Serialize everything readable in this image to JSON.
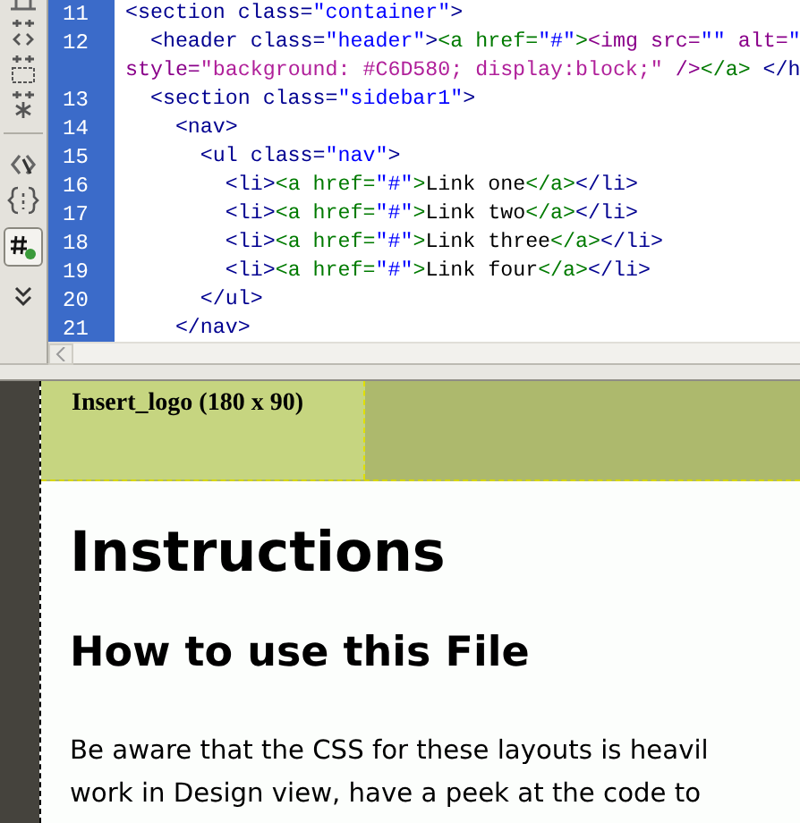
{
  "code_view": {
    "lines": [
      {
        "number": "11",
        "segments": [
          {
            "kind": "tag",
            "text": "<section class="
          },
          {
            "kind": "string",
            "text": "\"container\""
          },
          {
            "kind": "tag",
            "text": ">"
          }
        ]
      },
      {
        "number": "12",
        "segments": [
          {
            "kind": "tag",
            "text": "  <header class="
          },
          {
            "kind": "string",
            "text": "\"header\""
          },
          {
            "kind": "tag",
            "text": ">"
          },
          {
            "kind": "anchor",
            "text": "<a href="
          },
          {
            "kind": "string",
            "text": "\"#\""
          },
          {
            "kind": "anchor",
            "text": ">"
          },
          {
            "kind": "image",
            "text": "<img src="
          },
          {
            "kind": "string",
            "text": "\"\""
          },
          {
            "kind": "image",
            "text": " alt="
          },
          {
            "kind": "string",
            "text": "\""
          }
        ]
      },
      {
        "segments": [
          {
            "kind": "image",
            "text": "style="
          },
          {
            "kind": "css",
            "text": "\"background: #C6D580; display:block;\""
          },
          {
            "kind": "image",
            "text": " />"
          },
          {
            "kind": "anchor",
            "text": "</a>"
          },
          {
            "kind": "tag",
            "text": " </h"
          }
        ]
      },
      {
        "number": "13",
        "segments": [
          {
            "kind": "tag",
            "text": "  <section class="
          },
          {
            "kind": "string",
            "text": "\"sidebar1\""
          },
          {
            "kind": "tag",
            "text": ">"
          }
        ]
      },
      {
        "number": "14",
        "segments": [
          {
            "kind": "tag",
            "text": "    <nav>"
          }
        ]
      },
      {
        "number": "15",
        "segments": [
          {
            "kind": "tag",
            "text": "      <ul class="
          },
          {
            "kind": "string",
            "text": "\"nav\""
          },
          {
            "kind": "tag",
            "text": ">"
          }
        ]
      },
      {
        "number": "16",
        "segments": [
          {
            "kind": "tag",
            "text": "        <li>"
          },
          {
            "kind": "anchor",
            "text": "<a href="
          },
          {
            "kind": "string",
            "text": "\"#\""
          },
          {
            "kind": "anchor",
            "text": ">"
          },
          {
            "kind": "text",
            "text": "Link one"
          },
          {
            "kind": "anchor",
            "text": "</a>"
          },
          {
            "kind": "tag",
            "text": "</li>"
          }
        ]
      },
      {
        "number": "17",
        "segments": [
          {
            "kind": "tag",
            "text": "        <li>"
          },
          {
            "kind": "anchor",
            "text": "<a href="
          },
          {
            "kind": "string",
            "text": "\"#\""
          },
          {
            "kind": "anchor",
            "text": ">"
          },
          {
            "kind": "text",
            "text": "Link two"
          },
          {
            "kind": "anchor",
            "text": "</a>"
          },
          {
            "kind": "tag",
            "text": "</li>"
          }
        ]
      },
      {
        "number": "18",
        "segments": [
          {
            "kind": "tag",
            "text": "        <li>"
          },
          {
            "kind": "anchor",
            "text": "<a href="
          },
          {
            "kind": "string",
            "text": "\"#\""
          },
          {
            "kind": "anchor",
            "text": ">"
          },
          {
            "kind": "text",
            "text": "Link three"
          },
          {
            "kind": "anchor",
            "text": "</a>"
          },
          {
            "kind": "tag",
            "text": "</li>"
          }
        ]
      },
      {
        "number": "19",
        "segments": [
          {
            "kind": "tag",
            "text": "        <li>"
          },
          {
            "kind": "anchor",
            "text": "<a href="
          },
          {
            "kind": "string",
            "text": "\"#\""
          },
          {
            "kind": "anchor",
            "text": ">"
          },
          {
            "kind": "text",
            "text": "Link four"
          },
          {
            "kind": "anchor",
            "text": "</a>"
          },
          {
            "kind": "tag",
            "text": "</li>"
          }
        ]
      },
      {
        "number": "20",
        "segments": [
          {
            "kind": "tag",
            "text": "      </ul>"
          }
        ]
      },
      {
        "number": "21",
        "segments": [
          {
            "kind": "tag",
            "text": "    </nav>"
          }
        ]
      }
    ]
  },
  "design_view": {
    "logo_placeholder": "Insert_logo (180 x 90)",
    "heading": "Instructions",
    "subheading": "How to use this File",
    "paragraph_lines": [
      "Be aware that the CSS for these layouts is heavil",
      "work in Design view, have a peek at the code to"
    ]
  }
}
